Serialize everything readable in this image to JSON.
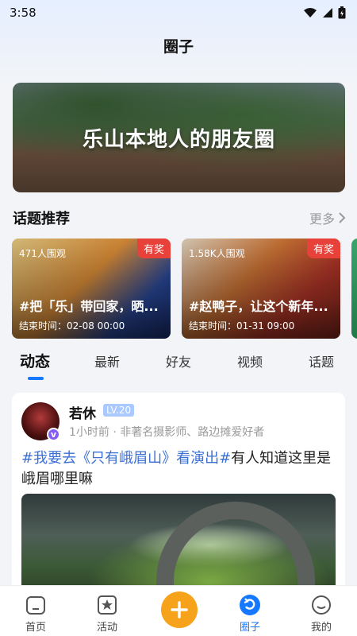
{
  "status_bar": {
    "time": "3:58"
  },
  "header": {
    "title": "圈子"
  },
  "banner": {
    "text": "乐山本地人的朋友圈"
  },
  "topics_section": {
    "title": "话题推荐",
    "more_label": "更多",
    "items": [
      {
        "views": "471人围观",
        "badge": "有奖",
        "name": "#把「乐」带回家，晒...",
        "end_time": "结束时间：02-08 00:00"
      },
      {
        "views": "1.58K人围观",
        "badge": "有奖",
        "name": "#赵鸭子，让这个新年...",
        "end_time": "结束时间：01-31 09:00"
      }
    ]
  },
  "feed_tabs": [
    "动态",
    "最新",
    "好友",
    "视频",
    "话题"
  ],
  "post": {
    "user_name": "若休",
    "level": "LV.20",
    "verified_mark": "v",
    "meta": "1小时前 · 非著名摄影师、路边摊爱好者",
    "tag": "#我要去《只有峨眉山》看演出#",
    "text": "有人知道这里是峨眉哪里嘛"
  },
  "bottom_nav": {
    "items": [
      {
        "label": "首页",
        "icon": "home-icon"
      },
      {
        "label": "活动",
        "icon": "activity-star-icon"
      },
      {
        "label": "圈子",
        "icon": "circle-refresh-icon"
      },
      {
        "label": "我的",
        "icon": "smile-face-icon"
      }
    ],
    "active_index": 2,
    "fab_icon": "plus-icon"
  },
  "colors": {
    "accent": "#1677ff",
    "fab": "#f7a21b",
    "badge": "#e8413a",
    "hashtag": "#3a6fd6"
  }
}
